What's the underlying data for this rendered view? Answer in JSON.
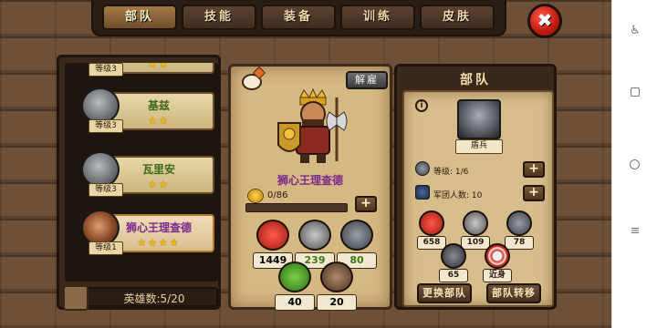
{
  "tabs": [
    {
      "label": "部队",
      "active": true
    },
    {
      "label": "技能",
      "active": false
    },
    {
      "label": "装备",
      "active": false
    },
    {
      "label": "训练",
      "active": false
    },
    {
      "label": "皮肤",
      "active": false
    }
  ],
  "close_glyph": "✖",
  "hero_list": {
    "partial_top_level": "等级3",
    "items": [
      {
        "name": "基兹",
        "stars": "★★",
        "level": "等级3",
        "selected": false
      },
      {
        "name": "瓦里安",
        "stars": "★★",
        "level": "等级3",
        "selected": false
      },
      {
        "name": "狮心王理查德",
        "stars": "★★★★",
        "level": "等级1",
        "selected": true
      }
    ],
    "count_label": "英雄数:5/20"
  },
  "hero_detail": {
    "dismiss_label": "解雇",
    "name": "狮心王理查德",
    "xp_text": "0/86",
    "xp_fraction": 0.0,
    "plus_glyph": "+",
    "stats": [
      {
        "icon": "heart-icon",
        "value": "1449",
        "color": "#2a1a0c"
      },
      {
        "icon": "sword-icon",
        "value": "239",
        "color": "#3d7a1a"
      },
      {
        "icon": "shield-icon",
        "value": "80",
        "color": "#3d7a1a"
      },
      {
        "icon": "clover-icon",
        "value": "40",
        "color": "#2a1a0c"
      },
      {
        "icon": "boot-icon",
        "value": "20",
        "color": "#2a1a0c"
      }
    ]
  },
  "unit_panel": {
    "title": "部队",
    "info_glyph": "i",
    "unit_name": "盾兵",
    "level_text": "等级: 1/6",
    "legion_text": "军团人数: 10",
    "stats": [
      {
        "icon": "heart-icon",
        "value": "658"
      },
      {
        "icon": "sword-icon",
        "value": "109"
      },
      {
        "icon": "shield-icon",
        "value": "78"
      },
      {
        "icon": "helmet-icon",
        "value": "65"
      },
      {
        "icon": "target-icon",
        "value": "近身"
      }
    ],
    "swap_label": "更换部队",
    "convert_label": "部队转移"
  },
  "accent_colors": {
    "selected_name": "#7a2a8c",
    "normal_name": "#3d6b1a",
    "star": "#f1b90b"
  }
}
